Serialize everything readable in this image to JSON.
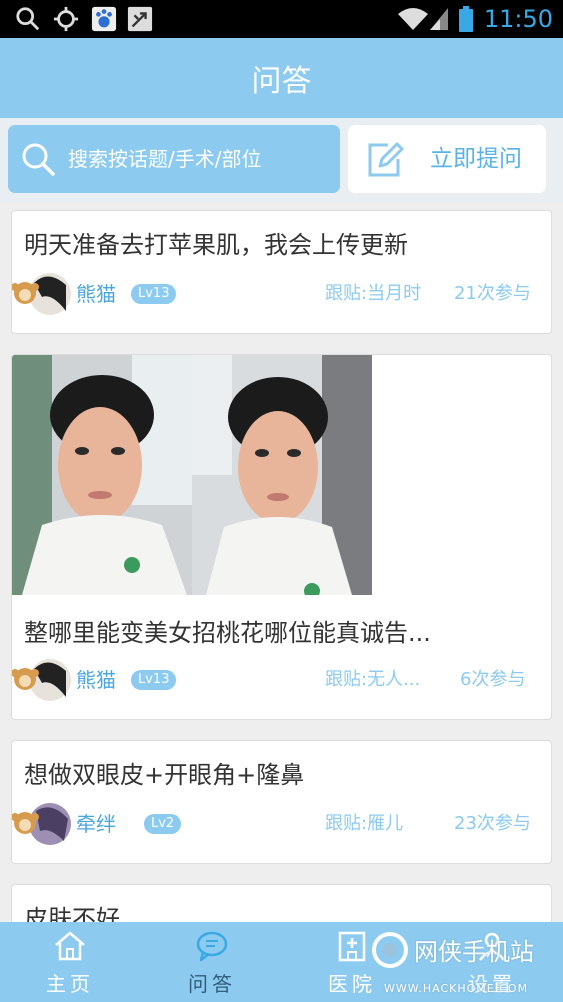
{
  "status_bar": {
    "time": "11:50",
    "icons": [
      "search-icon",
      "gps-icon",
      "baidu-icon",
      "tools-icon",
      "wifi-icon",
      "signal-icon",
      "battery-icon"
    ]
  },
  "header": {
    "title": "问答"
  },
  "search": {
    "placeholder": "搜索按话题/手术/部位",
    "ask_label": "立即提问"
  },
  "posts": [
    {
      "title": "明天准备去打苹果肌，我会上传更新",
      "user": "熊猫",
      "level": "Lv13",
      "follow": "跟贴:当月时",
      "participants": "21次参与",
      "has_photos": false
    },
    {
      "title": "整哪里能变美女招桃花哪位能真诚告...",
      "user": "熊猫",
      "level": "Lv13",
      "follow": "跟贴:无人...",
      "participants": "6次参与",
      "has_photos": true
    },
    {
      "title": "想做双眼皮+开眼角+隆鼻",
      "user": "牵绊",
      "level": "Lv2",
      "follow": "跟贴:雁儿",
      "participants": "23次参与",
      "has_photos": false
    },
    {
      "title": "皮肤不好"
    }
  ],
  "bottom_nav": [
    {
      "label": "主页",
      "icon": "home-icon"
    },
    {
      "label": "问答",
      "icon": "qa-chat-icon",
      "active": true
    },
    {
      "label": "医院",
      "icon": "hospital-icon"
    },
    {
      "label": "设置",
      "icon": "settings-icon"
    }
  ],
  "watermark": {
    "text": "网侠手机站",
    "sub": "WWW.HACKHOME.COM"
  },
  "colors": {
    "accent": "#8ccbef",
    "accent_text": "#4aa6de",
    "background": "#eeeeee"
  }
}
